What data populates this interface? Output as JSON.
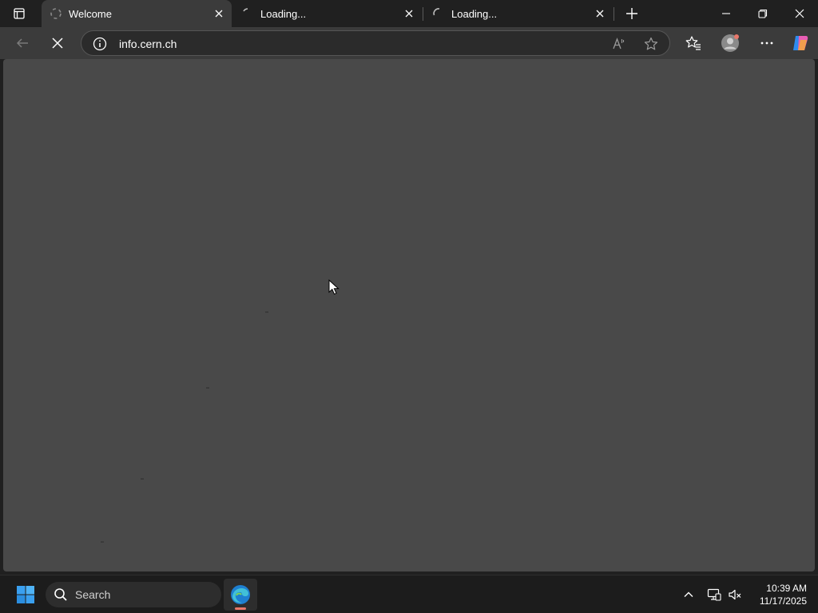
{
  "browser": {
    "tabs": [
      {
        "label": "Welcome",
        "active": true
      },
      {
        "label": "Loading...",
        "active": false
      },
      {
        "label": "Loading...",
        "active": false
      }
    ],
    "address": {
      "url": "info.cern.ch",
      "icons": [
        "info-icon",
        "read-aloud-icon",
        "favorite-star-icon"
      ]
    },
    "toolbar_icons": [
      "back-arrow-icon",
      "stop-loading-icon",
      "favorites-icon",
      "profile-avatar-icon",
      "more-icon",
      "copilot-icon"
    ]
  },
  "taskbar": {
    "search_placeholder": "Search",
    "clock": {
      "time": "10:39 AM",
      "date": "11/17/2025"
    },
    "tray_icons": [
      "chevron-up-icon",
      "network-icon",
      "volume-muted-icon"
    ]
  },
  "colors": {
    "chrome": "#202020",
    "toolbar": "#3b3b3b",
    "content": "#494949",
    "accent_indicator": "#e8776a"
  }
}
